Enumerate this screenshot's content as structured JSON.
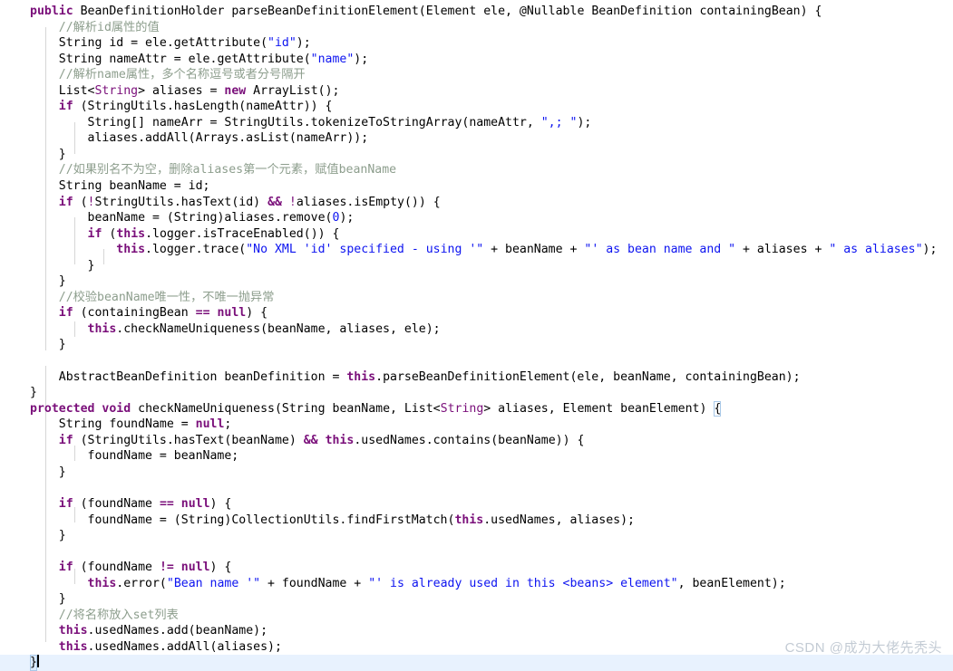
{
  "editor": {
    "language": "java",
    "theme": "light",
    "font_size_px": 13,
    "colors": {
      "background": "#ffffff",
      "text": "#000000",
      "keyword": "#7a0f7a",
      "string": "#0d14f0",
      "comment": "#8d9e8d",
      "indent_guide": "#d6d6d6",
      "current_line": "#e8f2fe",
      "bracket_match_border": "#a8c8e8",
      "watermark": "#c3cbd4"
    },
    "caret": {
      "line_index": 40,
      "column": 1
    },
    "current_line_index": 40
  },
  "watermark": {
    "text": "CSDN @成为大佬先秃头"
  },
  "code": {
    "lines": [
      "public BeanDefinitionHolder parseBeanDefinitionElement(Element ele, @Nullable BeanDefinition containingBean) {",
      "    //解析id属性的值",
      "    String id = ele.getAttribute(\"id\");",
      "    String nameAttr = ele.getAttribute(\"name\");",
      "    //解析name属性，多个名称逗号或者分号隔开",
      "    List<String> aliases = new ArrayList();",
      "    if (StringUtils.hasLength(nameAttr)) {",
      "        String[] nameArr = StringUtils.tokenizeToStringArray(nameAttr, \",; \");",
      "        aliases.addAll(Arrays.asList(nameArr));",
      "    }",
      "    //如果别名不为空，删除aliases第一个元素，赋值beanName",
      "    String beanName = id;",
      "    if (!StringUtils.hasText(id) && !aliases.isEmpty()) {",
      "        beanName = (String)aliases.remove(0);",
      "        if (this.logger.isTraceEnabled()) {",
      "            this.logger.trace(\"No XML 'id' specified - using '\" + beanName + \"' as bean name and \" + aliases + \" as aliases\");",
      "        }",
      "    }",
      "    //校验beanName唯一性，不唯一抛异常",
      "    if (containingBean == null) {",
      "        this.checkNameUniqueness(beanName, aliases, ele);",
      "    }",
      "",
      "    AbstractBeanDefinition beanDefinition = this.parseBeanDefinitionElement(ele, beanName, containingBean);",
      "}",
      "protected void checkNameUniqueness(String beanName, List<String> aliases, Element beanElement) {",
      "    String foundName = null;",
      "    if (StringUtils.hasText(beanName) && this.usedNames.contains(beanName)) {",
      "        foundName = beanName;",
      "    }",
      "",
      "    if (foundName == null) {",
      "        foundName = (String)CollectionUtils.findFirstMatch(this.usedNames, aliases);",
      "    }",
      "",
      "    if (foundName != null) {",
      "        this.error(\"Bean name '\" + foundName + \"' is already used in this <beans> element\", beanElement);",
      "    }",
      "    //将名称放入set列表",
      "    this.usedNames.add(beanName);",
      "    this.usedNames.addAll(aliases);",
      "}"
    ]
  }
}
